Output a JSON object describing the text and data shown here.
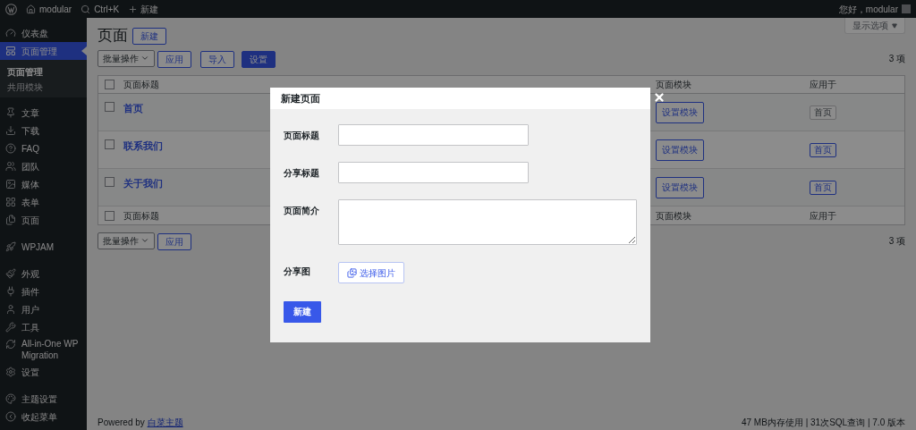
{
  "top_bar": {
    "site": "modular",
    "search": "Ctrl+K",
    "new": "新建",
    "greeting": "您好，modular"
  },
  "sidebar": {
    "sections": [
      {
        "items": [
          {
            "label": "仪表盘",
            "selected": false
          },
          {
            "label": "页面管理",
            "selected": true,
            "children": [
              {
                "label": "页面管理",
                "selected": true
              },
              {
                "label": "共用模块",
                "selected": false
              }
            ]
          }
        ]
      },
      {
        "items": [
          {
            "label": "文章",
            "selected": false
          },
          {
            "label": "下载",
            "selected": false
          },
          {
            "label": "FAQ",
            "selected": false
          },
          {
            "label": "团队",
            "selected": false
          },
          {
            "label": "媒体",
            "selected": false
          },
          {
            "label": "表单",
            "selected": false
          },
          {
            "label": "页面",
            "selected": false
          }
        ]
      },
      {
        "items": [
          {
            "label": "WPJAM",
            "selected": false
          }
        ]
      },
      {
        "items": [
          {
            "label": "外观",
            "selected": false
          },
          {
            "label": "插件",
            "selected": false
          },
          {
            "label": "用户",
            "selected": false
          },
          {
            "label": "工具",
            "selected": false
          },
          {
            "label": "All-in-One WP Migration",
            "selected": false
          },
          {
            "label": "设置",
            "selected": false
          }
        ]
      },
      {
        "items": [
          {
            "label": "主题设置",
            "selected": false
          },
          {
            "label": "收起菜单",
            "selected": false
          }
        ]
      }
    ]
  },
  "page": {
    "title": "页面",
    "add_new": "新建",
    "screen_options": "显示选项",
    "bulk_actions": "批量操作",
    "apply": "应用",
    "import": "导入",
    "settings": "设置",
    "count": "3 项",
    "table": {
      "header_checked": false,
      "footer_checked": false,
      "columns": [
        "页面标题",
        "页面模块",
        "应用于"
      ],
      "rows": [
        {
          "checked": false,
          "title": "首页",
          "module_button": "设置模块",
          "applies_to": {
            "label": "首页",
            "active": false
          }
        },
        {
          "checked": false,
          "title": "联系我们",
          "module_button": "设置模块",
          "applies_to": {
            "label": "首页",
            "active": true
          }
        },
        {
          "checked": false,
          "title": "关于我们",
          "module_button": "设置模块",
          "applies_to": {
            "label": "首页",
            "active": true
          }
        }
      ],
      "footer_columns": [
        "页面标题",
        "页面模块",
        "应用于"
      ]
    },
    "bottom": {
      "bulk_actions": "批量操作",
      "apply": "应用",
      "count": "3 项"
    }
  },
  "footer": {
    "credit": "Powered by",
    "credit_link": "白菜主题",
    "stats": "47 MB内存使用 | 31次SQL查询 | 7.0 版本"
  },
  "modal": {
    "title": "新建页面",
    "fields": [
      {
        "kind": "text",
        "label": "页面标题"
      },
      {
        "kind": "text",
        "label": "分享标题"
      },
      {
        "kind": "textarea",
        "label": "页面简介"
      },
      {
        "kind": "image",
        "label": "分享图",
        "button": "选择图片"
      }
    ],
    "submit": "新建"
  }
}
